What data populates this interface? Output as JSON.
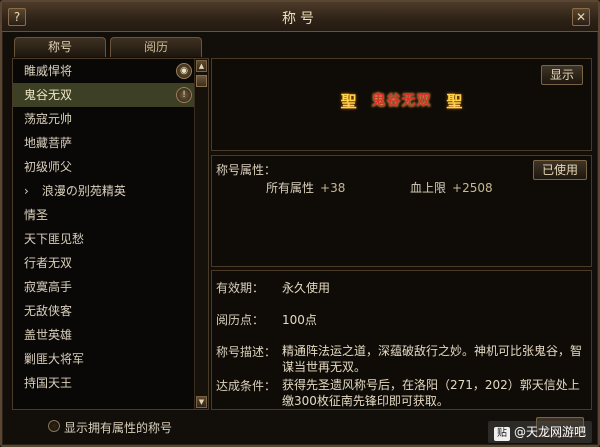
{
  "window": {
    "title": "称号"
  },
  "titlebar": {
    "help_label": "?",
    "close_label": "✕"
  },
  "tabs": [
    {
      "label": "称号"
    },
    {
      "label": "阅历"
    }
  ],
  "title_list": {
    "items": [
      {
        "label": "睢威悍将"
      },
      {
        "label": "鬼谷无双"
      },
      {
        "label": "荡寇元帅"
      },
      {
        "label": "地藏菩萨"
      },
      {
        "label": "初级师父"
      },
      {
        "label": "浪漫の别苑精英"
      },
      {
        "label": "情圣"
      },
      {
        "label": "天下匪见愁"
      },
      {
        "label": "行者无双"
      },
      {
        "label": "寂寞高手"
      },
      {
        "label": "无敌侠客"
      },
      {
        "label": "盖世英雄"
      },
      {
        "label": "剿匪大将军"
      },
      {
        "label": "持国天王"
      },
      {
        "label": "…"
      }
    ],
    "selected_index": 1,
    "expand_icon": "›",
    "eye_icon_glyph": "◉",
    "alert_icon_glyph": "!"
  },
  "scrollbar": {
    "up_glyph": "▲",
    "down_glyph": "▼"
  },
  "preview": {
    "show_button": "显示",
    "banner_text": "鬼谷无双",
    "seal_left": "聖",
    "seal_right": "聖"
  },
  "attributes": {
    "header": "称号属性：",
    "used_button": "已使用",
    "a_label": "所有属性",
    "a_value": "+38",
    "b_label": "血上限",
    "b_value": "+2508"
  },
  "info": {
    "validity_label": "有效期：",
    "validity_value": "永久使用",
    "experience_label": "阅历点：",
    "experience_value": "100点",
    "desc_label": "称号描述：",
    "desc_value": "精通阵法运之道，深蕴破敌行之妙。神机可比张鬼谷，智谋当世再无双。",
    "condition_label": "达成条件：",
    "condition_value": "获得先圣遗风称号后，在洛阳（271，202）郭天信处上缴300枚征南先锋印即可获取。"
  },
  "bottom": {
    "filter_label": "显示拥有属性的称号"
  },
  "watermark": {
    "logo": "贴",
    "text": "@天龙网游吧"
  }
}
